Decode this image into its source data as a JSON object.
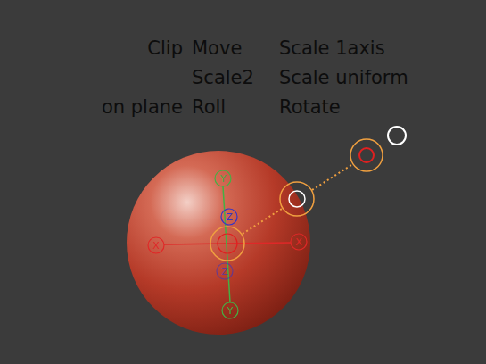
{
  "labels": [
    [
      "Clip",
      "Move",
      "Scale 1axis"
    ],
    [
      "",
      "Scale2",
      "Scale uniform"
    ],
    [
      "on plane",
      "Roll",
      "Rotate"
    ]
  ],
  "gizmo": {
    "axes": [
      {
        "label": "X",
        "color": "#e02828"
      },
      {
        "label": "Y",
        "color": "#44b044"
      },
      {
        "label": "Z",
        "color": "#3434c8"
      }
    ]
  }
}
